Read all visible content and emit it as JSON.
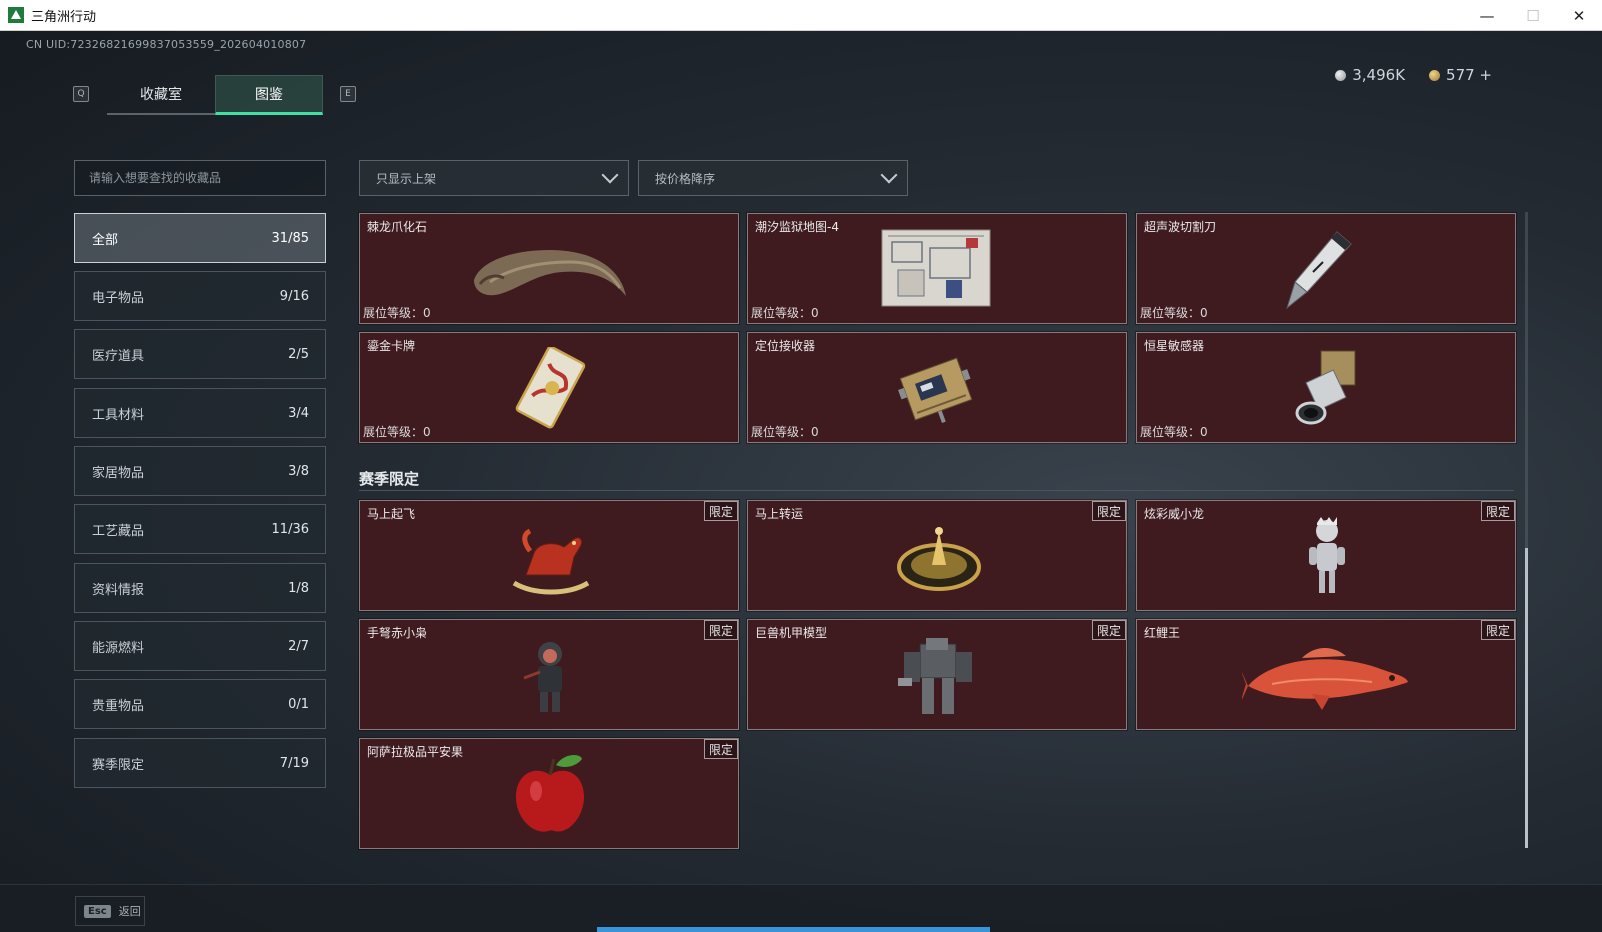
{
  "window": {
    "title": "三角洲行动"
  },
  "uid": "CN UID:72326821699837053559_202604010807",
  "tabs": {
    "q_key": "Q",
    "e_key": "E",
    "items": [
      {
        "label": "收藏室",
        "active": false
      },
      {
        "label": "图鉴",
        "active": true
      }
    ]
  },
  "currency": {
    "silver": "3,496K",
    "gold": "577 +"
  },
  "search": {
    "placeholder": "请输入想要查找的收藏品"
  },
  "categories": [
    {
      "label": "全部",
      "count": "31/85",
      "active": true
    },
    {
      "label": "电子物品",
      "count": "9/16"
    },
    {
      "label": "医疗道具",
      "count": "2/5"
    },
    {
      "label": "工具材料",
      "count": "3/4"
    },
    {
      "label": "家居物品",
      "count": "3/8"
    },
    {
      "label": "工艺藏品",
      "count": "11/36"
    },
    {
      "label": "资料情报",
      "count": "1/8"
    },
    {
      "label": "能源燃料",
      "count": "2/7"
    },
    {
      "label": "贵重物品",
      "count": "0/1"
    },
    {
      "label": "赛季限定",
      "count": "7/19"
    }
  ],
  "filters": {
    "shelf": "只显示上架",
    "sort": "按价格降序"
  },
  "level_label": "展位等级：0",
  "items": [
    {
      "name": "棘龙爪化石",
      "icon": "claw-fossil-icon"
    },
    {
      "name": "潮汐监狱地图-4",
      "icon": "map-icon"
    },
    {
      "name": "超声波切割刀",
      "icon": "ultrasonic-knife-icon"
    },
    {
      "name": "鎏金卡牌",
      "icon": "gilded-card-icon"
    },
    {
      "name": "定位接收器",
      "icon": "gps-receiver-icon"
    },
    {
      "name": "恒星敏感器",
      "icon": "star-sensor-icon"
    }
  ],
  "season": {
    "title": "赛季限定",
    "badge": "限定",
    "items": [
      {
        "name": "马上起飞",
        "icon": "rocking-horse-icon"
      },
      {
        "name": "马上转运",
        "icon": "golden-wheel-icon"
      },
      {
        "name": "炫彩威小龙",
        "icon": "dragon-figure-icon"
      },
      {
        "name": "手弩赤小枭",
        "icon": "crossbow-figure-icon"
      },
      {
        "name": "巨兽机甲模型",
        "icon": "mech-model-icon"
      },
      {
        "name": "红鲤王",
        "icon": "red-carp-icon"
      },
      {
        "name": "阿萨拉极品平安果",
        "icon": "apple-icon"
      }
    ]
  },
  "footer": {
    "esc_key": "Esc",
    "back_label": "返回"
  },
  "colors": {
    "card_bg": "#3f1b20",
    "tab_accent": "#3fe0a3",
    "progress": "#3a95d8"
  }
}
